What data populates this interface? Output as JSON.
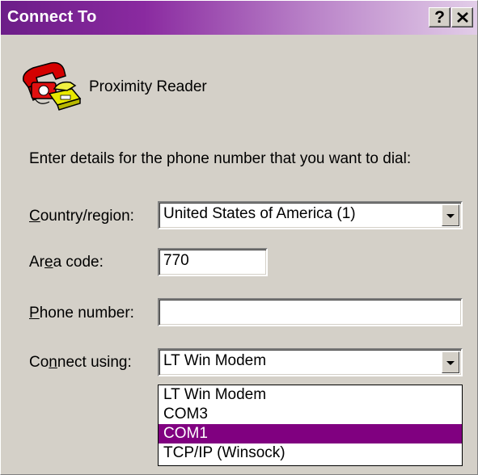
{
  "window": {
    "title": "Connect To",
    "help_label": "?",
    "close_label": "✕",
    "accent": "#800080"
  },
  "connection": {
    "icon": "phone-connection-icon",
    "name": "Proximity Reader"
  },
  "instructions": "Enter details for the phone number that you want to dial:",
  "country": {
    "label_prefix": "",
    "label_access": "C",
    "label_rest": "ountry/region:",
    "value": "United States of America (1)"
  },
  "area_code": {
    "label_prefix": "Ar",
    "label_access": "e",
    "label_rest": "a code:",
    "value": "770"
  },
  "phone": {
    "label_prefix": "",
    "label_access": "P",
    "label_rest": "hone number:",
    "value": ""
  },
  "connect_using": {
    "label_prefix": "Co",
    "label_access": "n",
    "label_rest": "nect using:",
    "value": "LT Win Modem",
    "options": [
      "LT Win Modem",
      "COM3",
      "COM1",
      "TCP/IP (Winsock)"
    ],
    "highlighted": "COM1"
  }
}
